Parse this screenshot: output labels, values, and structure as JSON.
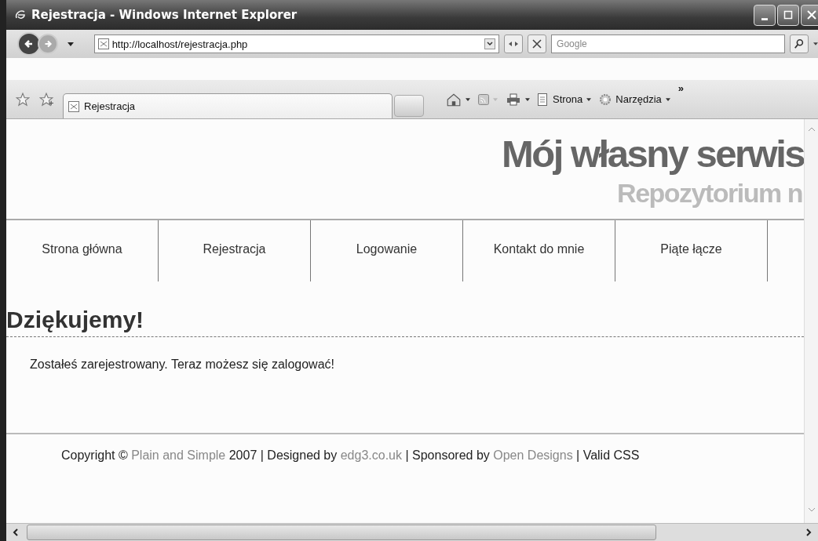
{
  "window": {
    "title": "Rejestracja - Windows Internet Explorer"
  },
  "address": {
    "url": "http://localhost/rejestracja.php"
  },
  "search": {
    "placeholder": "Google"
  },
  "tabs": [
    {
      "label": "Rejestracja",
      "selected": true
    }
  ],
  "command_bar": [
    {
      "kind": "home"
    },
    {
      "kind": "feed"
    },
    {
      "kind": "print"
    },
    {
      "kind": "page",
      "label": "Strona"
    },
    {
      "kind": "tools",
      "label": "Narzędzia"
    },
    {
      "kind": "more",
      "label": "»"
    }
  ],
  "page": {
    "site_title": "Mój własny serwis",
    "site_subtitle": "Repozytorium n",
    "nav": [
      "Strona główna",
      "Rejestracja",
      "Logowanie",
      "Kontakt do mnie",
      "Piąte łącze"
    ],
    "heading": "Dziękujemy!",
    "message": "Zostałeś zarejestrowany. Teraz możesz się zalogować!",
    "footer": [
      {
        "kind": "text",
        "text": "Copyright © "
      },
      {
        "kind": "link",
        "text": "Plain and Simple"
      },
      {
        "kind": "text",
        "text": " 2007 | Designed by "
      },
      {
        "kind": "link",
        "text": "edg3.co.uk"
      },
      {
        "kind": "text",
        "text": " | Sponsored by "
      },
      {
        "kind": "link",
        "text": "Open Designs"
      },
      {
        "kind": "text",
        "text": " | Valid CSS"
      }
    ]
  }
}
